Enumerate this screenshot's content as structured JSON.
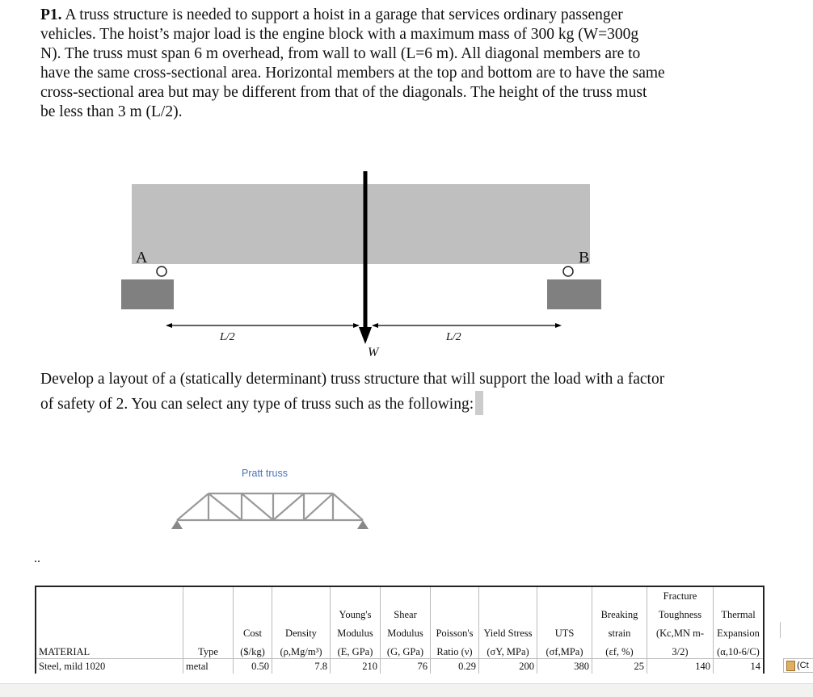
{
  "problem": {
    "lines": [
      "P1. A truss structure is needed to support a hoist in a garage that services ordinary passenger",
      "vehicles. The hoist’s major load is the engine block with a maximum mass of 300 kg (W=300g",
      "N). The truss must span 6 m overhead, from wall to wall (L=6 m). All diagonal members are to",
      "have the same cross-sectional area. Horizontal members at the top and bottom are to have the same",
      "cross-sectional area but may be different from that of the diagonals. The height of the truss must",
      "be less than 3 m (L/2)."
    ],
    "label_bold": "P1."
  },
  "figure": {
    "label_a": "A",
    "label_b": "B",
    "half_left": "L/2",
    "half_right": "L/2",
    "load": "W"
  },
  "develop": {
    "lines": [
      "Develop a layout of a (statically determinant) truss structure that will support the load with a factor",
      "of safety of 2. You can select any type of truss such as the following:"
    ]
  },
  "truss_example": {
    "caption": "Pratt truss",
    "color": "#4a72b8"
  },
  "dots": "..",
  "table": {
    "headers": [
      [
        "",
        "",
        "MATERIAL"
      ],
      [
        "",
        "",
        "Type"
      ],
      [
        "",
        "Cost",
        "($/kg)"
      ],
      [
        "",
        "Density",
        "(ρ,Mg/m³)"
      ],
      [
        "Young's",
        "Modulus",
        "(E, GPa)"
      ],
      [
        "Shear",
        "Modulus",
        "(G, GPa)"
      ],
      [
        "",
        "Poisson's",
        "Ratio (ν)"
      ],
      [
        "",
        "Yield Stress",
        "(σY, MPa)"
      ],
      [
        "",
        "UTS",
        "(σf,MPa)"
      ],
      [
        "Breaking",
        "strain",
        "(εf, %)"
      ],
      [
        "Fracture",
        "Toughness",
        "(Kc,MN m-3/2)"
      ],
      [
        "Thermal",
        "Expansion",
        "(α,10-6/C)"
      ]
    ],
    "row": [
      "Steel, mild 1020",
      "metal",
      "0.50",
      "7.8",
      "210",
      "76",
      "0.29",
      "200",
      "380",
      "25",
      "140",
      "14"
    ]
  },
  "paste_options": {
    "label": "(Ct",
    "icon": "clipboard-icon"
  }
}
